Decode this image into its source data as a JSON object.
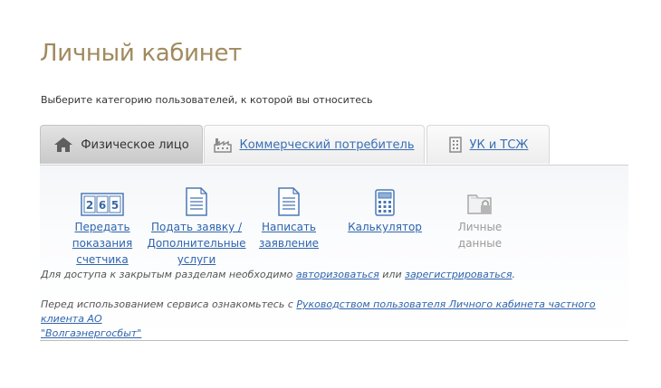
{
  "page": {
    "title": "Личный кабинет",
    "subtitle": "Выберите категорию пользователей, к которой вы относитесь"
  },
  "tabs": [
    {
      "label": "Физическое лицо",
      "icon": "house-icon",
      "active": true
    },
    {
      "label": "Коммерческий потребитель",
      "icon": "factory-icon",
      "active": false
    },
    {
      "label": "УК и ТСЖ",
      "icon": "building-icon",
      "active": false
    }
  ],
  "services": [
    {
      "label_line1": "Передать показания",
      "label_line2": "счетчика",
      "label_line3": "",
      "icon": "meter-digits-icon",
      "digits": [
        "2",
        "6",
        "5"
      ],
      "enabled": true
    },
    {
      "label_line1": "Подать заявку /",
      "label_line2": "Дополнительные",
      "label_line3": "услуги",
      "icon": "document-icon",
      "enabled": true
    },
    {
      "label_line1": "Написать",
      "label_line2": "заявление",
      "label_line3": "",
      "icon": "document-icon",
      "enabled": true
    },
    {
      "label_line1": "Калькулятор",
      "label_line2": "",
      "label_line3": "",
      "icon": "calculator-icon",
      "enabled": true
    },
    {
      "label_line1": "Личные данные",
      "label_line2": "",
      "label_line3": "",
      "icon": "locked-folder-icon",
      "enabled": false
    }
  ],
  "access_notice": {
    "prefix": "Для доступа к закрытым разделам необходимо ",
    "login_link": "авторизоваться",
    "middle": " или ",
    "register_link": "зарегистрироваться",
    "suffix": "."
  },
  "guide_notice": {
    "prefix": "Перед использованием сервиса ознакомьтесь с ",
    "link_line1": "Руководством пользователя Личного кабинета частного клиента АО",
    "link_line2": "\"Волгаэнергосбыт\""
  },
  "colors": {
    "title": "#a08a5e",
    "link": "#2e64ad",
    "icon_blue": "#4a78b5",
    "disabled": "#9a9a9a"
  }
}
